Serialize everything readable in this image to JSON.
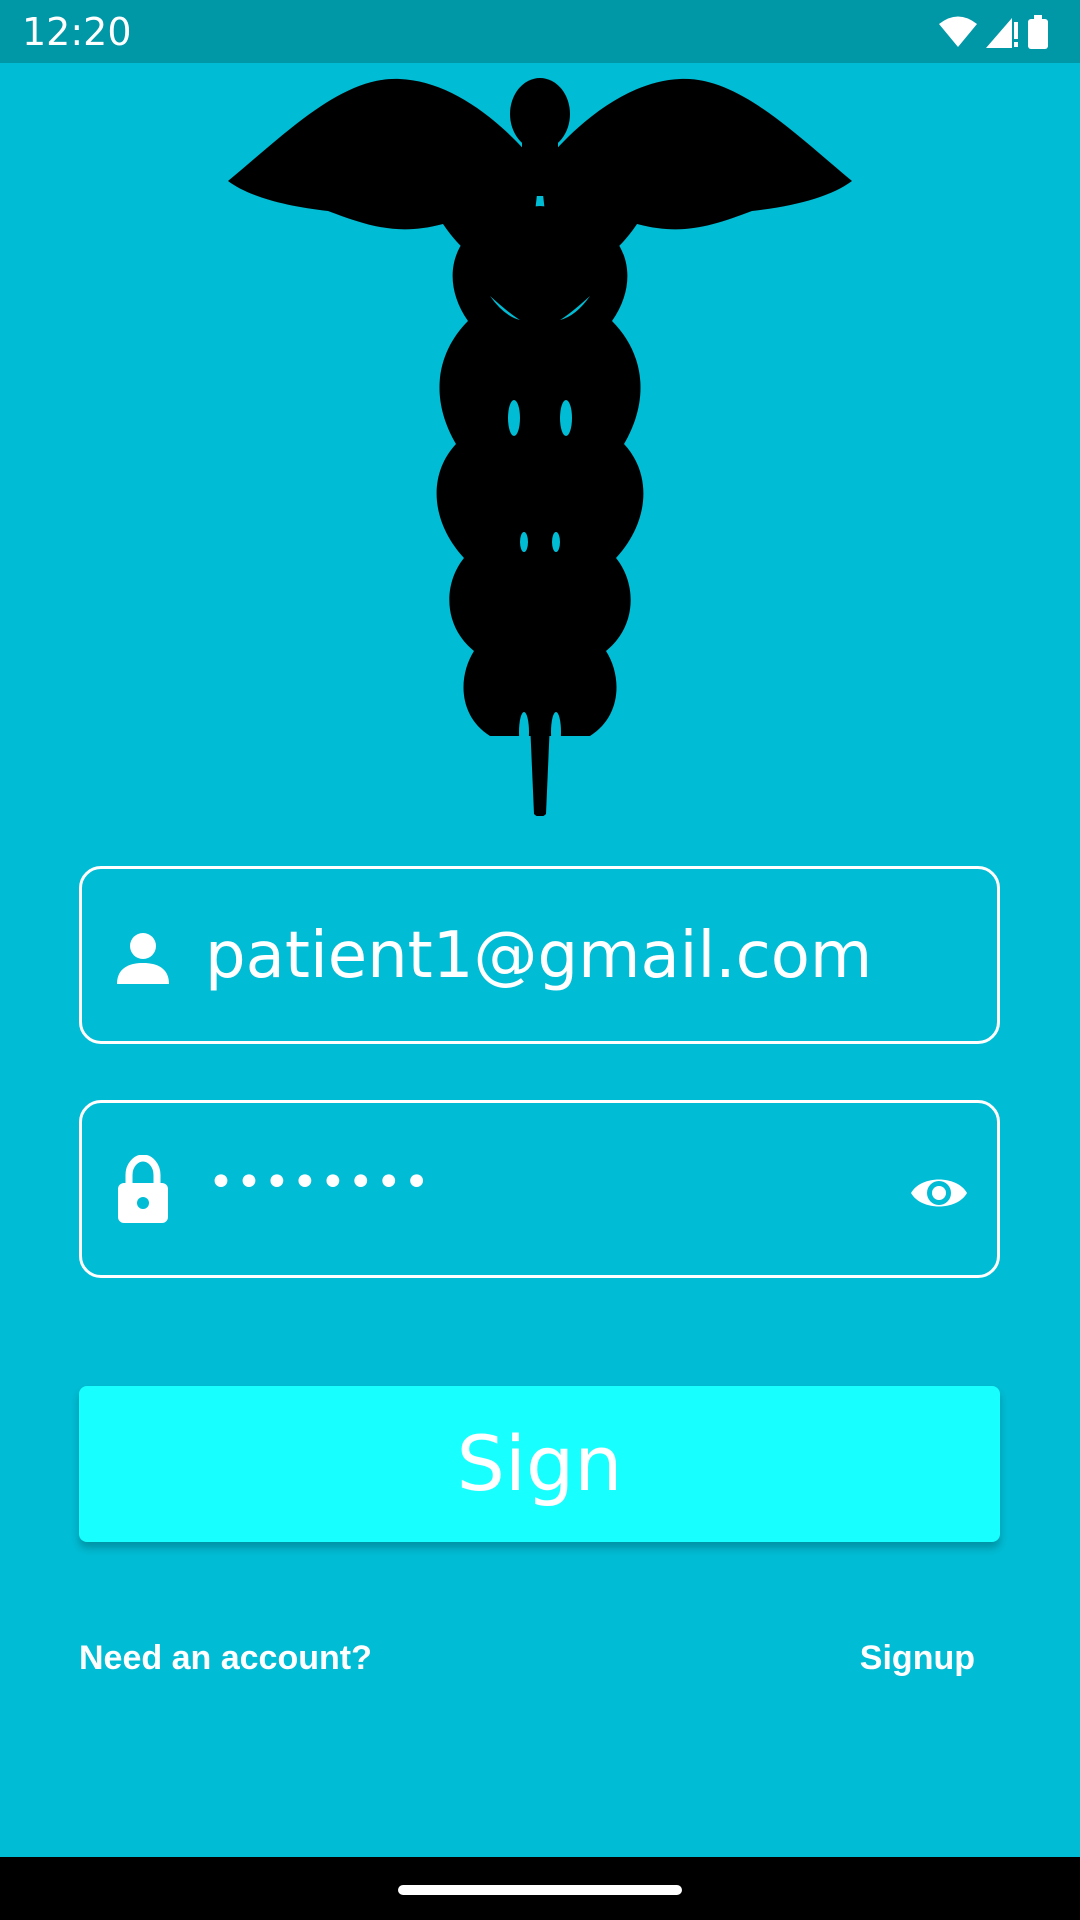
{
  "status_bar": {
    "time": "12:20",
    "icons": [
      "wifi-icon",
      "cell-signal-icon",
      "battery-icon"
    ]
  },
  "logo": {
    "name": "caduceus-logo"
  },
  "login_form": {
    "email": {
      "value": "patient1@gmail.com",
      "icon": "person-icon"
    },
    "password": {
      "masked_value": "••••••••",
      "icon": "lock-icon",
      "toggle_icon": "eye-icon"
    },
    "sign_button_label": "Sign"
  },
  "footer": {
    "prompt": "Need an account?",
    "signup_label": "Signup"
  },
  "colors": {
    "background": "#00BCD4",
    "status_bar": "#0097A7",
    "button": "#18FFFF",
    "text": "#FFFFFF"
  }
}
